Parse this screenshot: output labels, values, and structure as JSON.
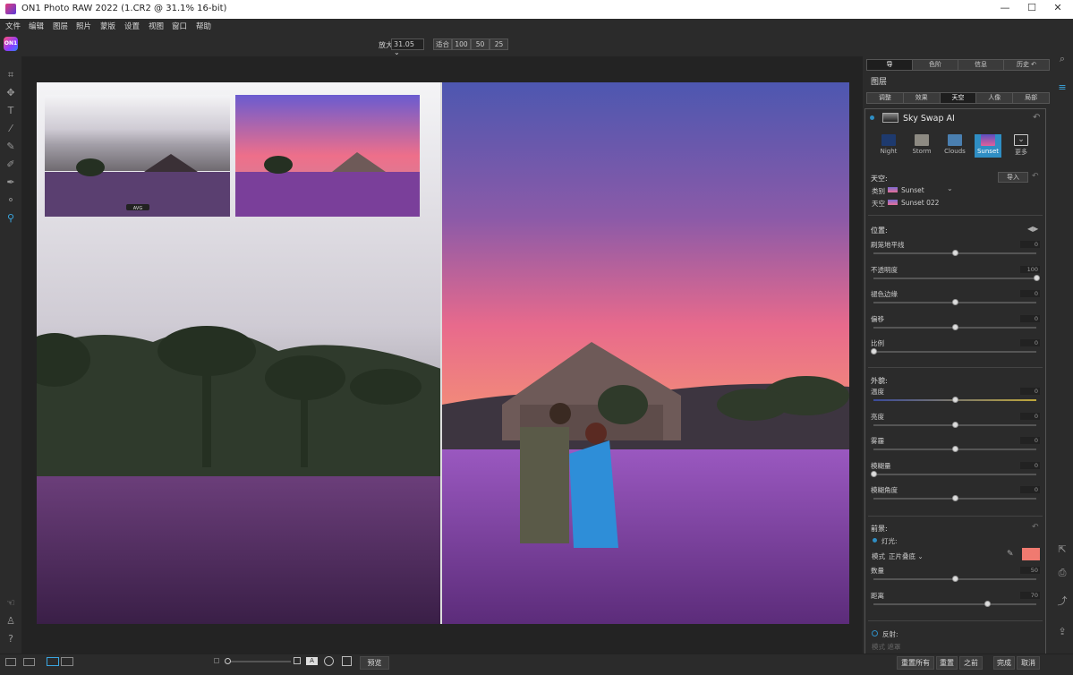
{
  "window": {
    "title": "ON1 Photo RAW 2022 (1.CR2 @ 31.1% 16-bit)",
    "min": "—",
    "max": "☐",
    "close": "✕"
  },
  "menu": [
    "文件",
    "编辑",
    "图层",
    "照片",
    "蒙版",
    "设置",
    "视图",
    "窗口",
    "帮助"
  ],
  "logo": "ON1",
  "zoom": {
    "label": "放大",
    "value": "31.05 ⌄",
    "fit": "适合",
    "z100": "100",
    "z50": "50",
    "z25": "25"
  },
  "top_tabs": [
    "导",
    "色阶",
    "信息",
    "历史 ↶"
  ],
  "panel": {
    "layers_title": "图层",
    "filter_tabs": [
      "调整",
      "效果",
      "天空",
      "人像",
      "局部"
    ],
    "active_filter_tab": "天空",
    "filter_name": "Sky Swap AI",
    "sky_presets": [
      {
        "label": "Night",
        "color": "#1e3a6e"
      },
      {
        "label": "Storm",
        "color": "#8d8a82"
      },
      {
        "label": "Clouds",
        "color": "#4a7fb0"
      },
      {
        "label": "Sunset",
        "color": "#d05a9a"
      },
      {
        "label": "更多",
        "color": "#2b2b2b"
      }
    ],
    "active_preset": "Sunset",
    "sky_section": "天空:",
    "import_btn": "导入",
    "category_label": "类别",
    "category_value": "Sunset",
    "sky_label": "天空",
    "sky_value": "Sunset 022",
    "position_section": "位置:",
    "sliders_position": [
      {
        "label": "刷笼地平线",
        "value": "0",
        "pos": 0.5
      },
      {
        "label": "不透明度",
        "value": "100",
        "pos": 1.0
      },
      {
        "label": "褪色边缘",
        "value": "0",
        "pos": 0.5
      },
      {
        "label": "偏移",
        "value": "0",
        "pos": 0.5
      },
      {
        "label": "比例",
        "value": "0",
        "pos": 0.0
      }
    ],
    "appearance_section": "外貌:",
    "sliders_appearance": [
      {
        "label": "温度",
        "value": "0",
        "pos": 0.5
      },
      {
        "label": "亮度",
        "value": "0",
        "pos": 0.5
      },
      {
        "label": "雾霾",
        "value": "0",
        "pos": 0.5
      },
      {
        "label": "模糊量",
        "value": "0",
        "pos": 0.0
      },
      {
        "label": "模糊角度",
        "value": "0",
        "pos": 0.5
      }
    ],
    "foreground_section": "前景:",
    "lighting_label": "灯光:",
    "mode_label": "模式",
    "mode_value": "正片叠底 ⌄",
    "swatch_color": "#f07a70",
    "sliders_foreground": [
      {
        "label": "数量",
        "value": "50",
        "pos": 0.5
      },
      {
        "label": "距离",
        "value": "70",
        "pos": 0.7
      }
    ],
    "reflection_label": "反射:",
    "reflection_mode": "模式 遮罩"
  },
  "bottom": {
    "preview": "预览",
    "reset_all": "重置所有",
    "reset": "重置",
    "before": "之前",
    "done": "完成",
    "cancel": "取消"
  },
  "thumb_caption": "AVG",
  "colors": {
    "accent": "#2f8ec4",
    "panel_bg": "#2b2b2b"
  }
}
